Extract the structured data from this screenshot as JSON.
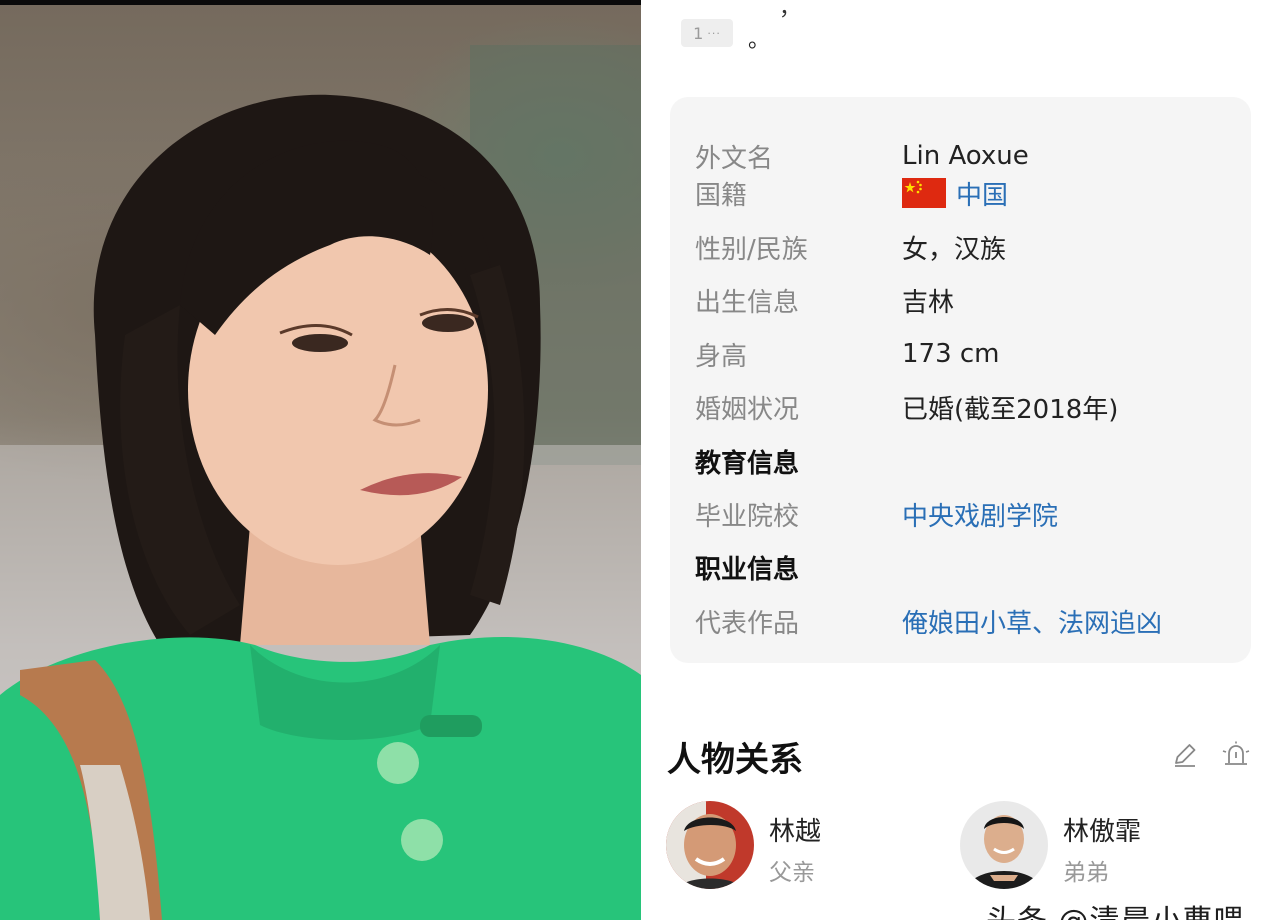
{
  "photo": {
    "subject": "portrait",
    "icon": "portrait-photo"
  },
  "footnote": {
    "ref_number": "1",
    "ref_more": "···",
    "period": "。",
    "clipped_top_text": "，"
  },
  "infobox": {
    "rows": [
      {
        "label": "外文名",
        "value": "Lin Aoxue",
        "kind": "text"
      },
      {
        "label": "国籍",
        "value": "中国",
        "kind": "link-flag"
      },
      {
        "label": "性别/民族",
        "value": "女，汉族",
        "kind": "text"
      },
      {
        "label": "出生信息",
        "value": "吉林",
        "kind": "text"
      },
      {
        "label": "身高",
        "value": "173 cm",
        "kind": "text"
      },
      {
        "label": "婚姻状况",
        "value": "已婚(截至2018年)",
        "kind": "text"
      },
      {
        "label": "教育信息",
        "value": "",
        "kind": "section"
      },
      {
        "label": "毕业院校",
        "value": "中央戏剧学院",
        "kind": "link"
      },
      {
        "label": "职业信息",
        "value": "",
        "kind": "section"
      },
      {
        "label": "代表作品",
        "value": "俺娘田小草、法网追凶",
        "kind": "link"
      }
    ]
  },
  "relations": {
    "title": "人物关系",
    "people": [
      {
        "name": "林越",
        "relation": "父亲"
      },
      {
        "name": "林傲霏",
        "relation": "弟弟"
      }
    ]
  },
  "watermark": "头条 @清晨小曹喂",
  "colors": {
    "link": "#2a6fb6",
    "label": "#888888",
    "panel_bg": "#f5f5f5",
    "sweater": "#27c47a"
  }
}
